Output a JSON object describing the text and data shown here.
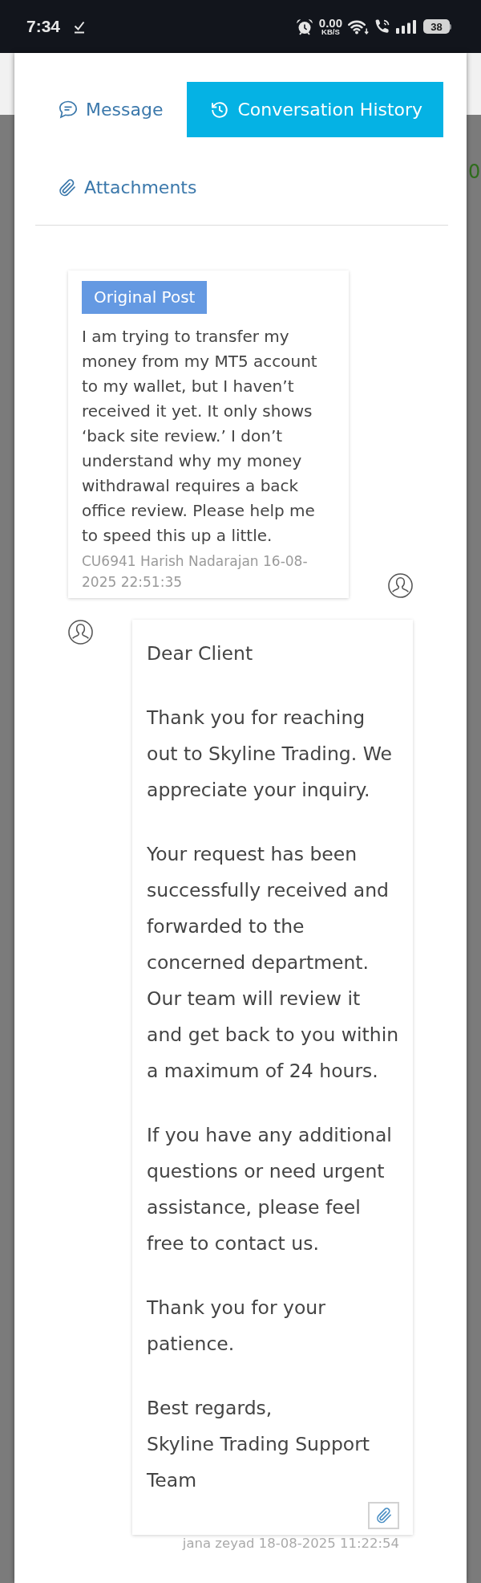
{
  "status_bar": {
    "time": "7:34",
    "network_speed": "0.00",
    "network_speed_unit": "KB/S",
    "battery": "38"
  },
  "background_page": {
    "text": "0"
  },
  "tabs": [
    {
      "label": "Message",
      "selected": false,
      "kind": "message"
    },
    {
      "label": "Conversation History",
      "selected": true,
      "kind": "history"
    },
    {
      "label": "Attachments",
      "selected": false,
      "kind": "attachments"
    }
  ],
  "conversation": [
    {
      "kind": "customer",
      "badge": "Original Post",
      "paragraphs": [
        "I am trying to transfer my money from my MT5 account to my wallet, but I haven’t received it yet. It only shows ‘back site review.’ I don’t understand why my money withdrawal requires a back office review. Please help me to speed this up a little."
      ],
      "meta": "CU6941 Harish Nadarajan 16-08-2025 22:51:35"
    },
    {
      "kind": "support",
      "paragraphs": [
        "Dear Client",
        "Thank you for reaching out to Skyline Trading. We appreciate your inquiry.",
        "Your request has been successfully received and forwarded to the concerned department. Our team will review it and get back to you within a maximum of 24 hours.",
        "If you have any additional questions or need urgent assistance, please feel free to contact us.",
        "Thank you for your patience.",
        "Best regards,\nSkyline Trading Support Team"
      ],
      "meta": "jana zeyad 18-08-2025 11:22:54",
      "attachment": true
    }
  ]
}
